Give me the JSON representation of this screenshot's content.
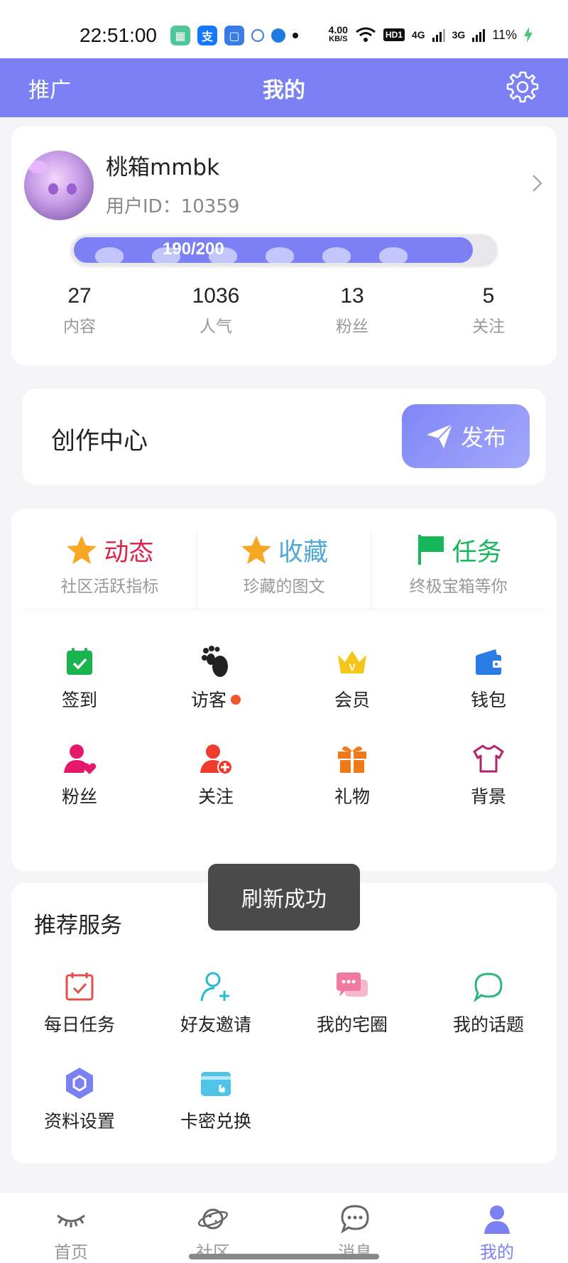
{
  "status_bar": {
    "time": "22:51:00",
    "speed_value": "4.00",
    "speed_unit": "KB/S",
    "hd_label": "HD1",
    "net_4g": "4G",
    "net_3g": "3G",
    "battery": "11%"
  },
  "nav": {
    "left_label": "推广",
    "title": "我的",
    "settings_icon": "gear-icon"
  },
  "profile": {
    "username": "桃箱mmbk",
    "user_id_label": "用户ID：",
    "user_id": "10359",
    "level_text": "190/200",
    "level_progress": 0.95,
    "stats": [
      {
        "value": "27",
        "label": "内容"
      },
      {
        "value": "1036",
        "label": "人气"
      },
      {
        "value": "13",
        "label": "粉丝"
      },
      {
        "value": "5",
        "label": "关注"
      }
    ]
  },
  "creation": {
    "title": "创作中心",
    "publish_label": "发布",
    "publish_icon": "paper-plane-icon"
  },
  "features": [
    {
      "name": "动态",
      "desc": "社区活跃指标",
      "color": "#d9264f",
      "icon": "star-icon"
    },
    {
      "name": "收藏",
      "desc": "珍藏的图文",
      "color": "#4fa9d8",
      "icon": "star-icon"
    },
    {
      "name": "任务",
      "desc": "终极宝箱等你",
      "color": "#16b65a",
      "icon": "flag-icon"
    }
  ],
  "quick_actions": [
    {
      "label": "签到",
      "icon": "calendar-check-icon",
      "color": "#19b34f"
    },
    {
      "label": "访客",
      "icon": "footprint-icon",
      "color": "#222222",
      "badge": true
    },
    {
      "label": "会员",
      "icon": "crown-icon",
      "color": "#f5c518"
    },
    {
      "label": "钱包",
      "icon": "wallet-icon",
      "color": "#2a7be4"
    },
    {
      "label": "粉丝",
      "icon": "user-heart-icon",
      "color": "#e6186b"
    },
    {
      "label": "关注",
      "icon": "user-add-icon",
      "color": "#ee3b2e"
    },
    {
      "label": "礼物",
      "icon": "gift-icon",
      "color": "#f07a1a"
    },
    {
      "label": "背景",
      "icon": "tshirt-icon",
      "color": "#b3226a"
    }
  ],
  "services": {
    "title": "推荐服务",
    "items": [
      {
        "label": "每日任务",
        "icon": "calendar-task-icon",
        "color": "#e0504a"
      },
      {
        "label": "好友邀请",
        "icon": "user-invite-icon",
        "color": "#23bcd2"
      },
      {
        "label": "我的宅圈",
        "icon": "chat-bubbles-icon",
        "color": "#f07aa0"
      },
      {
        "label": "我的话题",
        "icon": "speech-bubble-icon",
        "color": "#2eb67d"
      },
      {
        "label": "资料设置",
        "icon": "hexagon-settings-icon",
        "color": "#7b80f5"
      },
      {
        "label": "卡密兑换",
        "icon": "card-icon",
        "color": "#4fc3e8"
      }
    ]
  },
  "toast": "刷新成功",
  "tabs": [
    {
      "label": "首页",
      "icon": "eye-lash-icon",
      "active": false
    },
    {
      "label": "社区",
      "icon": "planet-icon",
      "active": false
    },
    {
      "label": "消息",
      "icon": "message-icon",
      "active": false
    },
    {
      "label": "我的",
      "icon": "person-icon",
      "active": true
    }
  ],
  "colors": {
    "accent": "#7b80f5",
    "background": "#f5f5f7",
    "muted_text": "#999999"
  }
}
